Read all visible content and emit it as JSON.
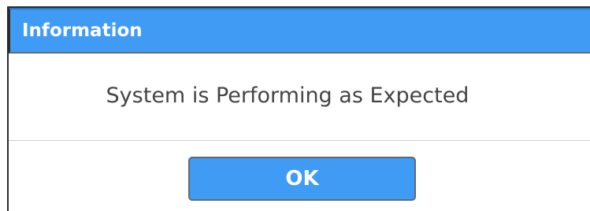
{
  "dialog": {
    "title": "Information",
    "message": "System is Performing as Expected",
    "ok_label": "OK"
  },
  "colors": {
    "titlebar": "#3f9bf4",
    "button": "#3f9bf4",
    "message_text": "#444444"
  }
}
